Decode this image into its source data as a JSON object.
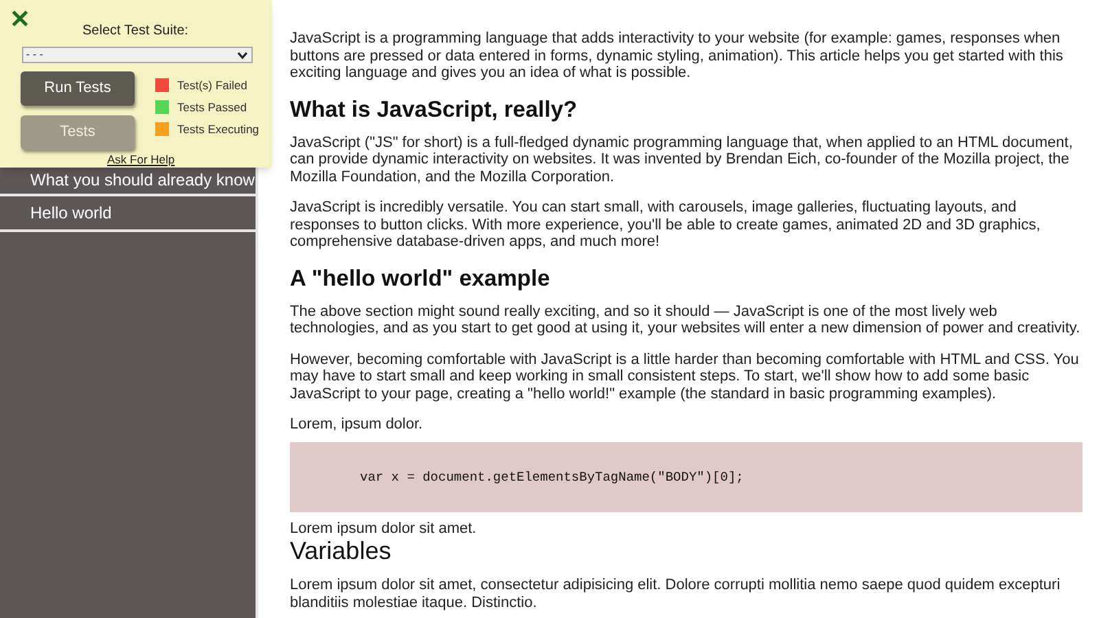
{
  "sidebar": {
    "items": [
      {
        "label": "What you should already know"
      },
      {
        "label": "Hello world"
      }
    ]
  },
  "test_panel": {
    "close": "✕",
    "label": "Select Test Suite:",
    "select_value": "- - -",
    "buttons": [
      {
        "label": "Run Tests",
        "disabled": false
      },
      {
        "label": "Tests",
        "disabled": true
      }
    ],
    "legend": [
      {
        "label": "Test(s) Failed",
        "color": "#f04a3c"
      },
      {
        "label": "Tests Passed",
        "color": "#55d455"
      },
      {
        "label": "Tests Executing",
        "color": "#f5a11d"
      }
    ],
    "help_link": "Ask For Help"
  },
  "content": [
    {
      "kind": "p",
      "text": "JavaScript is a programming language that adds interactivity to your website (for example: games, responses when buttons are pressed or data entered in forms, dynamic styling, animation). This article helps you get started with this exciting language and gives you an idea of what is possible."
    },
    {
      "kind": "h",
      "text": "What is JavaScript, really?"
    },
    {
      "kind": "p",
      "text": "JavaScript (\"JS\" for short) is a full-fledged dynamic programming language that, when applied to an HTML document, can provide dynamic interactivity on websites. It was invented by Brendan Eich, co-founder of the Mozilla project, the Mozilla Foundation, and the Mozilla Corporation."
    },
    {
      "kind": "p",
      "text": "JavaScript is incredibly versatile. You can start small, with carousels, image galleries, fluctuating layouts, and responses to button clicks. With more experience, you'll be able to create games, animated 2D and 3D graphics, comprehensive database-driven apps, and much more!"
    },
    {
      "kind": "h",
      "text": "A \"hello world\" example"
    },
    {
      "kind": "p",
      "text": "The above section might sound really exciting, and so it should — JavaScript is one of the most lively web technologies, and as you start to get good at using it, your websites will enter a new dimension of power and creativity."
    },
    {
      "kind": "p",
      "text": "However, becoming comfortable with JavaScript is a little harder than becoming comfortable with HTML and CSS. You may have to start small and keep working in small consistent steps. To start, we'll show how to add some basic JavaScript to your page, creating a \"hello world!\" example (the standard in basic programming examples)."
    },
    {
      "kind": "p",
      "text": "Lorem, ipsum dolor."
    },
    {
      "kind": "code",
      "text": "var x = document.getElementsByTagName(\"BODY\")[0];"
    },
    {
      "kind": "tight",
      "text": "Lorem ipsum dolor sit amet."
    },
    {
      "kind": "h2",
      "text": "Variables"
    },
    {
      "kind": "p",
      "text": "Lorem ipsum dolor sit amet, consectetur adipisicing elit. Dolore corrupti mollitia nemo saepe quod quidem excepturi blanditiis molestiae itaque. Distinctio."
    }
  ]
}
